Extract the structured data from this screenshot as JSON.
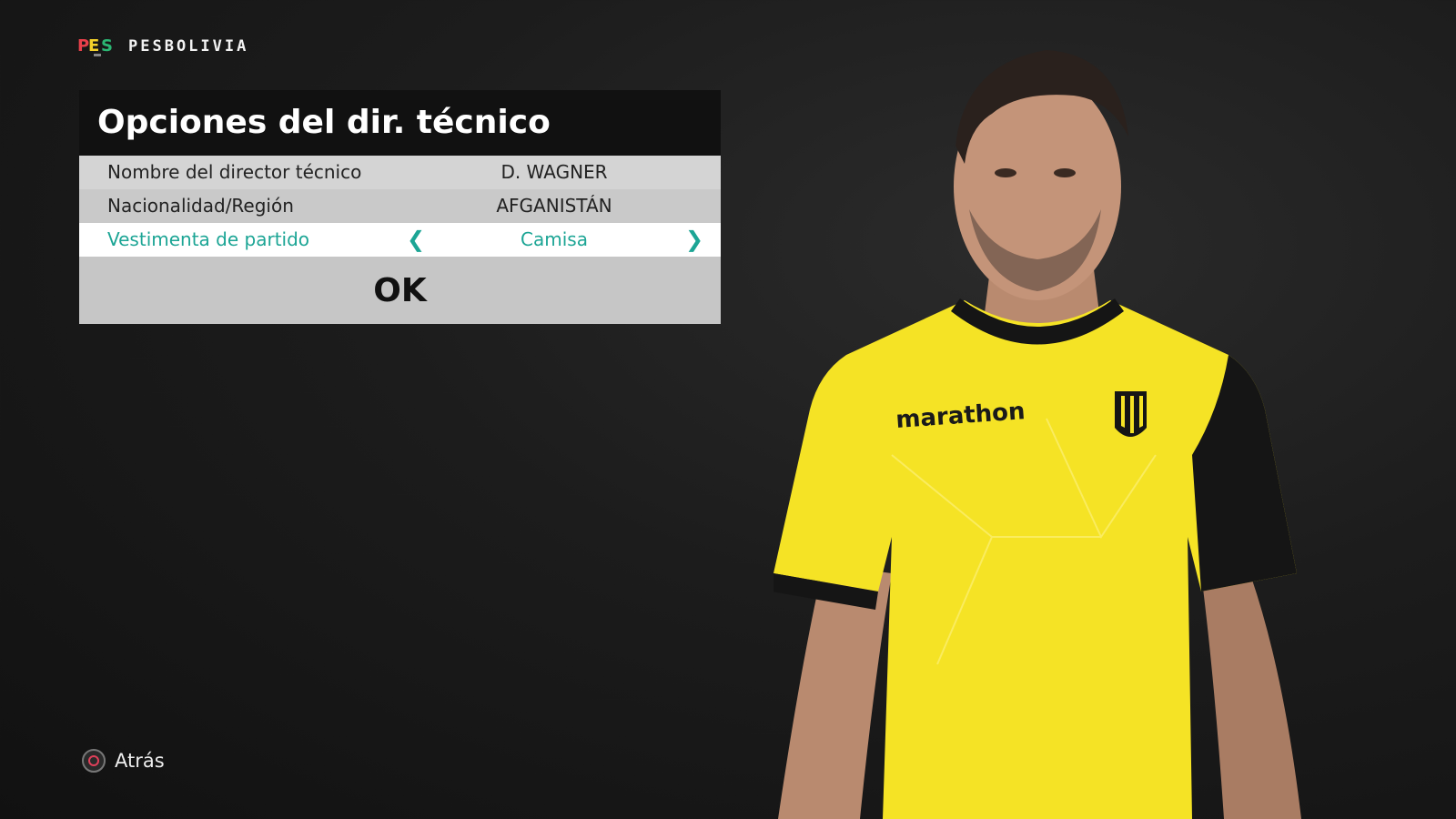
{
  "brand": {
    "name": "PESBOLIVIA",
    "logo_icon": "pes-logo-icon"
  },
  "panel": {
    "title": "Opciones del dir. técnico",
    "rows": [
      {
        "label": "Nombre del director técnico",
        "value": "D. WAGNER"
      },
      {
        "label": "Nacionalidad/Región",
        "value": "AFGANISTÁN"
      },
      {
        "label": "Vestimenta de partido",
        "value": "Camisa",
        "left_arrow": "❮",
        "right_arrow": "❯"
      }
    ],
    "ok_label": "OK"
  },
  "footer": {
    "back_label": "Atrás",
    "back_icon": "circle-button-icon"
  },
  "coach": {
    "shirt_brand": "marathon",
    "shirt_color": "#f5e325",
    "sleeve_color": "#151515"
  },
  "colors": {
    "accent": "#1ca595",
    "background": "#1c1c1c"
  }
}
